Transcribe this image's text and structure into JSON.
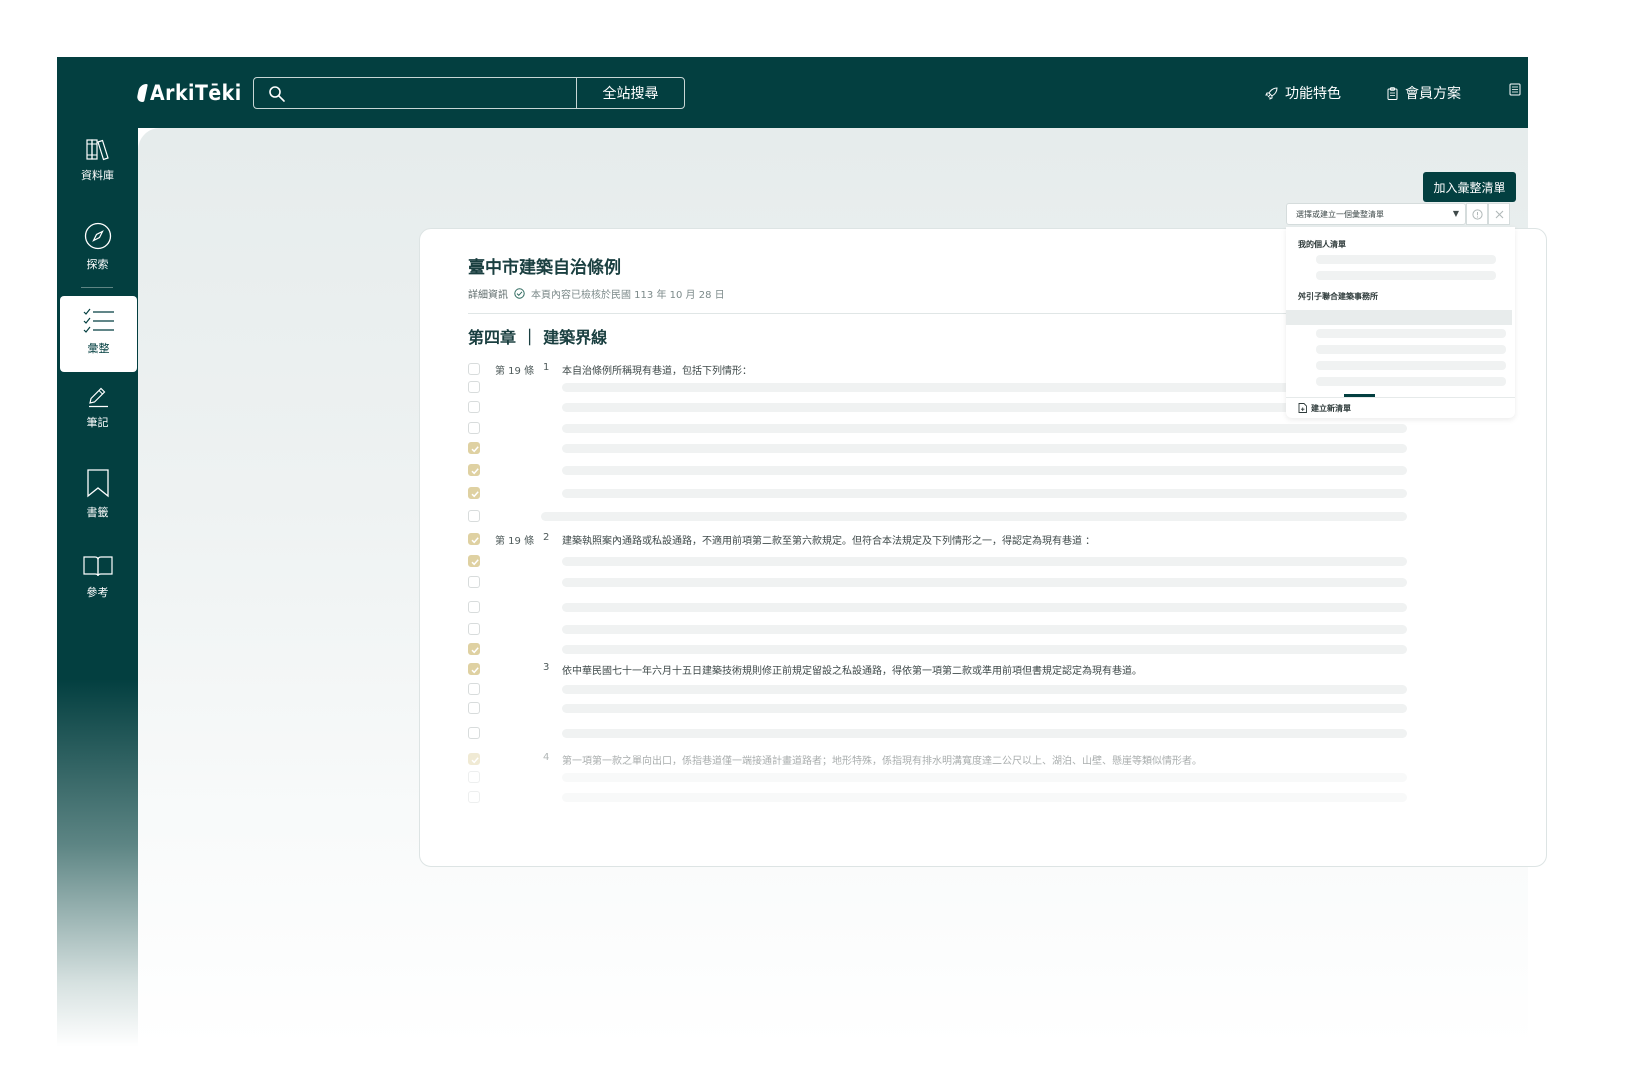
{
  "app": {
    "logo_text": "ArkiTēki"
  },
  "search": {
    "placeholder": "",
    "button_label": "全站搜尋"
  },
  "topnav": [
    {
      "label": "功能特色",
      "icon": "rocket-icon"
    },
    {
      "label": "會員方案",
      "icon": "clipboard-icon"
    },
    {
      "label": "",
      "icon": "document-icon"
    }
  ],
  "sidebar": [
    {
      "label": "資料庫",
      "icon": "library-icon",
      "active": false
    },
    {
      "label": "探索",
      "icon": "compass-icon",
      "active": false
    },
    {
      "label": "彙整",
      "icon": "checklist-icon",
      "active": true
    },
    {
      "label": "筆記",
      "icon": "pencil-icon",
      "active": false
    },
    {
      "label": "書籤",
      "icon": "bookmark-icon",
      "active": false
    },
    {
      "label": "參考",
      "icon": "book-icon",
      "active": false
    }
  ],
  "toolbar": {
    "add_label": "加入彙整清單"
  },
  "dropdown": {
    "select_placeholder": "選擇或建立一個彙整清單",
    "arrow": "▼",
    "section_personal": "我的個人清單",
    "section_firm": "舛引子聯合建築事務所",
    "create_label": "建立新清單"
  },
  "document": {
    "title": "臺中市建築自治條例",
    "meta_info": "詳細資訊",
    "meta_verified": "本頁內容已檢核於民國 113 年 10 月 28 日",
    "chapter": "第四章 ｜ 建築界線",
    "articles": [
      {
        "article": "第 19 條",
        "num": "1",
        "text": "本自治條例所稱現有巷道，包括下列情形："
      },
      {
        "article": "第 19 條",
        "num": "2",
        "text": "建築執照案內通路或私設通路，不適用前項第二款至第六款規定。但符合本法規定及下列情形之一，得認定為現有巷道 ："
      },
      {
        "article": "",
        "num": "3",
        "text": "依中華民國七十一年六月十五日建築技術規則修正前規定留設之私設通路，得依第一項第二款或準用前項但書規定認定為現有巷道。"
      },
      {
        "article": "",
        "num": "4",
        "text": "第一項第一款之單向出口，係指巷道僅一端接通計畫道路者；地形特殊，係指現有排水明溝寬度達二公尺以上、湖泊、山壁、懸崖等類似情形者。"
      }
    ]
  },
  "colors": {
    "brand": "#033f40",
    "check": "#dfd1a2",
    "bar": "#f0f2f2"
  }
}
